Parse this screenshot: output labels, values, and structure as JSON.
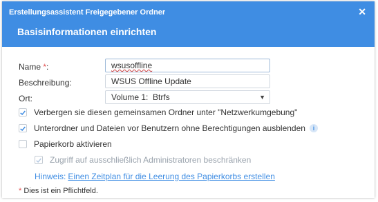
{
  "window": {
    "title": "Erstellungsassistent Freigegebener Ordner",
    "close_icon": "close-icon",
    "section_title": "Basisinformationen einrichten"
  },
  "form": {
    "name_label": "Name",
    "required_mark": "*",
    "name_colon": ":",
    "name_value": "wsusoffline",
    "description_label": "Beschreibung:",
    "description_value": "WSUS Offline Update",
    "location_label": "Ort:",
    "location_value": "Volume 1:  Btrfs"
  },
  "options": {
    "hide_network": {
      "label": "Verbergen sie diesen gemeinsamen Ordner unter \"Netzwerkumgebung\"",
      "checked": true
    },
    "hide_subfolders": {
      "label": "Unterordner und Dateien vor Benutzern ohne Berechtigungen ausblenden",
      "checked": true
    },
    "recycle_bin": {
      "label": "Papierkorb aktivieren",
      "checked": false
    },
    "admin_only": {
      "label": "Zugriff auf ausschließlich Administratoren beschränken",
      "checked": true,
      "disabled": true
    }
  },
  "hint": {
    "prefix": "Hinweis:",
    "link": "Einen Zeitplan für die Leerung des Papierkorbs erstellen"
  },
  "footnote": {
    "star": "*",
    "text": " Dies ist ein Pflichtfeld."
  },
  "colors": {
    "accent": "#3f8de3",
    "required": "#e04b4b"
  }
}
